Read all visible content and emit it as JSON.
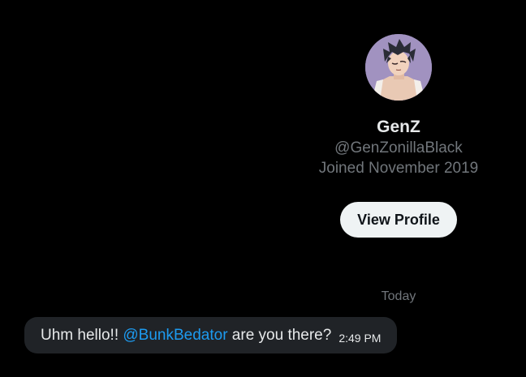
{
  "profile": {
    "display_name": "GenZ",
    "handle": "@GenZonillaBlack",
    "joined": "Joined November 2019",
    "view_profile_label": "View Profile"
  },
  "conversation": {
    "date_separator": "Today",
    "messages": [
      {
        "text_before": "Uhm hello!! ",
        "mention": "@BunkBedator",
        "text_after": " are you there?",
        "time": "2:49 PM"
      }
    ]
  },
  "colors": {
    "background": "#000000",
    "bubble": "#202327",
    "mention": "#1d9bf0",
    "muted_text": "#71767b",
    "button_bg": "#eff3f4"
  },
  "icons": {
    "avatar": "anime-character-avatar"
  }
}
